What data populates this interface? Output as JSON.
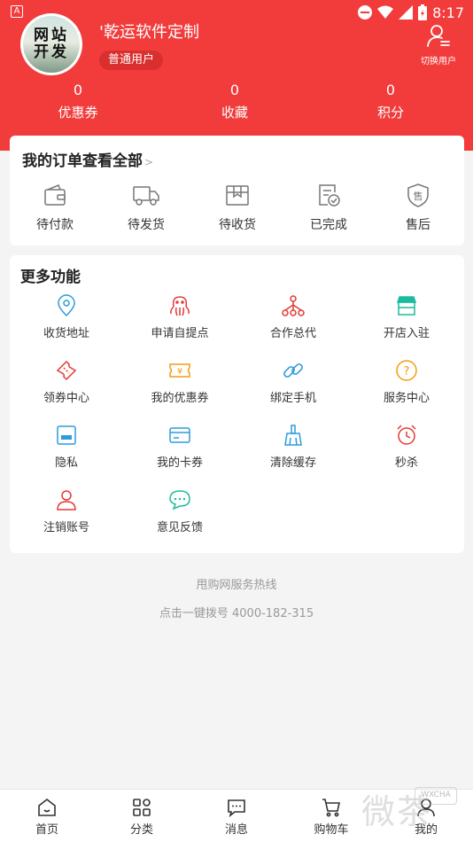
{
  "status_bar": {
    "time": "8:17",
    "indicator": "A"
  },
  "user": {
    "avatar_line1": "网站",
    "avatar_line2": "开发",
    "name": "'乾运软件定制",
    "badge": "普通用户",
    "switch_label": "切换用户"
  },
  "stats": [
    {
      "value": "0",
      "label": "优惠券"
    },
    {
      "value": "0",
      "label": "收藏"
    },
    {
      "value": "0",
      "label": "积分"
    }
  ],
  "orders": {
    "title": "我的订单查看全部",
    "chevron": ">",
    "items": [
      {
        "label": "待付款",
        "icon": "wallet-icon"
      },
      {
        "label": "待发货",
        "icon": "truck-icon"
      },
      {
        "label": "待收货",
        "icon": "package-icon"
      },
      {
        "label": "已完成",
        "icon": "completed-doc-icon"
      },
      {
        "label": "售后",
        "icon": "after-sales-shield-icon"
      }
    ]
  },
  "more": {
    "title": "更多功能",
    "items": [
      {
        "label": "收货地址",
        "icon": "location-pin-icon",
        "color": "#2d9cdb"
      },
      {
        "label": "申请自提点",
        "icon": "octopus-icon",
        "color": "#e53935"
      },
      {
        "label": "合作总代",
        "icon": "network-icon",
        "color": "#e53935"
      },
      {
        "label": "开店入驻",
        "icon": "shop-icon",
        "color": "#1abc9c"
      },
      {
        "label": "领券中心",
        "icon": "ticket-icon",
        "color": "#e53935"
      },
      {
        "label": "我的优惠券",
        "icon": "coupon-yen-icon",
        "color": "#f39c12"
      },
      {
        "label": "绑定手机",
        "icon": "link-icon",
        "color": "#2d9cdb"
      },
      {
        "label": "服务中心",
        "icon": "question-icon",
        "color": "#f39c12"
      },
      {
        "label": "隐私",
        "icon": "privacy-card-icon",
        "color": "#2d9cdb"
      },
      {
        "label": "我的卡券",
        "icon": "card-icon",
        "color": "#2d9cdb"
      },
      {
        "label": "清除缓存",
        "icon": "broom-icon",
        "color": "#2d9cdb"
      },
      {
        "label": "秒杀",
        "icon": "alarm-clock-icon",
        "color": "#e53935"
      },
      {
        "label": "注销账号",
        "icon": "user-icon",
        "color": "#e53935"
      },
      {
        "label": "意见反馈",
        "icon": "chat-bubble-icon",
        "color": "#1abc9c"
      }
    ]
  },
  "footer": {
    "hotline_title": "甩购网服务热线",
    "hotline": "点击一键拨号 4000-182-315"
  },
  "tabs": [
    {
      "label": "首页",
      "icon": "home-icon"
    },
    {
      "label": "分类",
      "icon": "category-icon"
    },
    {
      "label": "消息",
      "icon": "message-icon"
    },
    {
      "label": "购物车",
      "icon": "cart-icon"
    },
    {
      "label": "我的",
      "icon": "profile-icon"
    }
  ],
  "watermark": {
    "text": "微茶",
    "badge": "WXCHA"
  },
  "colors": {
    "brand_red": "#f23c3c",
    "badge_red": "#d92f2f",
    "background": "#f4f4f4"
  }
}
